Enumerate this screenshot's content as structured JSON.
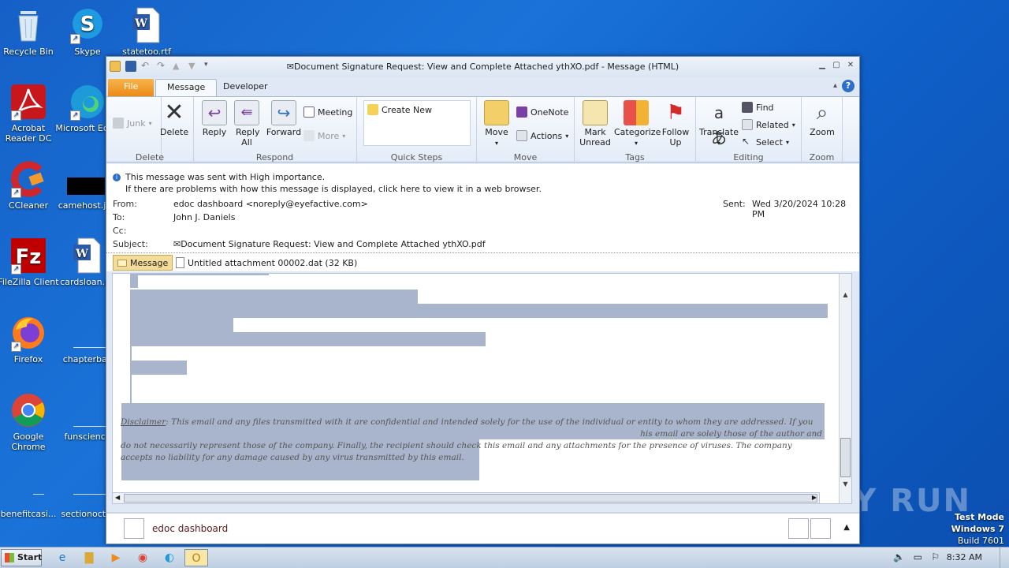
{
  "desktop": {
    "icons": [
      {
        "label": "Recycle Bin",
        "icon": "recycle-bin-icon"
      },
      {
        "label": "Skype",
        "icon": "skype-icon"
      },
      {
        "label": "statetoo.rtf",
        "icon": "word-doc-icon"
      },
      {
        "label": "Acrobat Reader DC",
        "icon": "acrobat-icon"
      },
      {
        "label": "Microsoft Edge",
        "icon": "edge-icon"
      },
      {
        "label": "CCleaner",
        "icon": "ccleaner-icon"
      },
      {
        "label": "camehost.jpg",
        "icon": "image-file-icon"
      },
      {
        "label": "FileZilla Client",
        "icon": "filezilla-icon"
      },
      {
        "label": "cardsloan.rtf",
        "icon": "word-doc-icon"
      },
      {
        "label": "Firefox",
        "icon": "firefox-icon"
      },
      {
        "label": "chapterbay",
        "icon": "file-icon"
      },
      {
        "label": "Google Chrome",
        "icon": "chrome-icon"
      },
      {
        "label": "funscience",
        "icon": "file-icon"
      },
      {
        "label": "benefitcasi...",
        "icon": "file-icon"
      },
      {
        "label": "sectionoct...",
        "icon": "file-icon"
      }
    ]
  },
  "window": {
    "title": "✉Document Signature Request: View and Complete Attached ythXO.pdf  -  Message (HTML)",
    "tabs": [
      "File",
      "Message",
      "Developer"
    ],
    "ribbon": {
      "groups": [
        "Delete",
        "Respond",
        "Quick Steps",
        "Move",
        "Tags",
        "Editing",
        "Zoom"
      ],
      "junk": "Junk",
      "delete": "Delete",
      "reply": "Reply",
      "reply_all": "Reply All",
      "forward": "Forward",
      "meeting": "Meeting",
      "more": "More",
      "create_new": "Create New",
      "move": "Move",
      "onenote": "OneNote",
      "actions": "Actions",
      "mark_unread": "Mark Unread",
      "categorize": "Categorize",
      "follow_up": "Follow Up",
      "translate": "Translate",
      "find": "Find",
      "related": "Related",
      "select": "Select",
      "zoom": "Zoom"
    },
    "info": {
      "line1": "This message was sent with High importance.",
      "line2": "If there are problems with how this message is displayed, click here to view it in a web browser."
    },
    "header": {
      "from_label": "From:",
      "from": "edoc dashboard <noreply@eyefactive.com>",
      "to_label": "To:",
      "to": "John J. Daniels",
      "cc_label": "Cc:",
      "subject_label": "Subject:",
      "subject": "✉Document Signature Request: View and Complete Attached ythXO.pdf",
      "sent_label": "Sent:",
      "sent": "Wed 3/20/2024 10:28 PM"
    },
    "attachments": {
      "message_tab": "Message",
      "file": "Untitled attachment 00002.dat (32 KB)"
    },
    "body": {
      "disclaimer_label": "Disclaimer",
      "disclaimer_line1": ": This email and any files transmitted with it are confidential and intended solely for the use of the individual or entity to whom they are addressed. If you",
      "disclaimer_line2": "his email are solely those of the author and",
      "disclaimer_line3": "do not necessarily represent those of the company. Finally, the recipient should check this email and any attachments for the presence of viruses. The company",
      "disclaimer_line4": "accepts no liability for any damage caused by any virus transmitted by this email."
    },
    "people_pane": {
      "name": "edoc dashboard"
    }
  },
  "taskbar": {
    "start": "Start",
    "clock": "8:32 AM"
  },
  "overlay": {
    "watermark": "ANY RUN",
    "test_mode": "Test Mode",
    "os": "Windows 7",
    "build": "Build 7601"
  },
  "colors": {
    "selection_highlight": "#a9b5cc",
    "file_tab": "#ec8a17",
    "desktop": "#1a6fd6"
  }
}
